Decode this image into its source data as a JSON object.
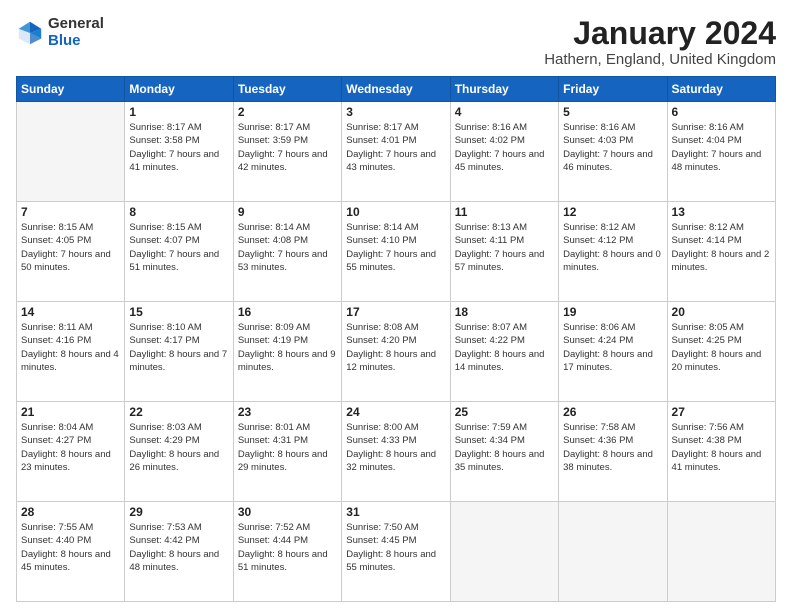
{
  "logo": {
    "general": "General",
    "blue": "Blue"
  },
  "header": {
    "month_title": "January 2024",
    "location": "Hathern, England, United Kingdom"
  },
  "days_of_week": [
    "Sunday",
    "Monday",
    "Tuesday",
    "Wednesday",
    "Thursday",
    "Friday",
    "Saturday"
  ],
  "weeks": [
    [
      {
        "day": "",
        "sunrise": "",
        "sunset": "",
        "daylight": ""
      },
      {
        "day": "1",
        "sunrise": "Sunrise: 8:17 AM",
        "sunset": "Sunset: 3:58 PM",
        "daylight": "Daylight: 7 hours and 41 minutes."
      },
      {
        "day": "2",
        "sunrise": "Sunrise: 8:17 AM",
        "sunset": "Sunset: 3:59 PM",
        "daylight": "Daylight: 7 hours and 42 minutes."
      },
      {
        "day": "3",
        "sunrise": "Sunrise: 8:17 AM",
        "sunset": "Sunset: 4:01 PM",
        "daylight": "Daylight: 7 hours and 43 minutes."
      },
      {
        "day": "4",
        "sunrise": "Sunrise: 8:16 AM",
        "sunset": "Sunset: 4:02 PM",
        "daylight": "Daylight: 7 hours and 45 minutes."
      },
      {
        "day": "5",
        "sunrise": "Sunrise: 8:16 AM",
        "sunset": "Sunset: 4:03 PM",
        "daylight": "Daylight: 7 hours and 46 minutes."
      },
      {
        "day": "6",
        "sunrise": "Sunrise: 8:16 AM",
        "sunset": "Sunset: 4:04 PM",
        "daylight": "Daylight: 7 hours and 48 minutes."
      }
    ],
    [
      {
        "day": "7",
        "sunrise": "Sunrise: 8:15 AM",
        "sunset": "Sunset: 4:05 PM",
        "daylight": "Daylight: 7 hours and 50 minutes."
      },
      {
        "day": "8",
        "sunrise": "Sunrise: 8:15 AM",
        "sunset": "Sunset: 4:07 PM",
        "daylight": "Daylight: 7 hours and 51 minutes."
      },
      {
        "day": "9",
        "sunrise": "Sunrise: 8:14 AM",
        "sunset": "Sunset: 4:08 PM",
        "daylight": "Daylight: 7 hours and 53 minutes."
      },
      {
        "day": "10",
        "sunrise": "Sunrise: 8:14 AM",
        "sunset": "Sunset: 4:10 PM",
        "daylight": "Daylight: 7 hours and 55 minutes."
      },
      {
        "day": "11",
        "sunrise": "Sunrise: 8:13 AM",
        "sunset": "Sunset: 4:11 PM",
        "daylight": "Daylight: 7 hours and 57 minutes."
      },
      {
        "day": "12",
        "sunrise": "Sunrise: 8:12 AM",
        "sunset": "Sunset: 4:12 PM",
        "daylight": "Daylight: 8 hours and 0 minutes."
      },
      {
        "day": "13",
        "sunrise": "Sunrise: 8:12 AM",
        "sunset": "Sunset: 4:14 PM",
        "daylight": "Daylight: 8 hours and 2 minutes."
      }
    ],
    [
      {
        "day": "14",
        "sunrise": "Sunrise: 8:11 AM",
        "sunset": "Sunset: 4:16 PM",
        "daylight": "Daylight: 8 hours and 4 minutes."
      },
      {
        "day": "15",
        "sunrise": "Sunrise: 8:10 AM",
        "sunset": "Sunset: 4:17 PM",
        "daylight": "Daylight: 8 hours and 7 minutes."
      },
      {
        "day": "16",
        "sunrise": "Sunrise: 8:09 AM",
        "sunset": "Sunset: 4:19 PM",
        "daylight": "Daylight: 8 hours and 9 minutes."
      },
      {
        "day": "17",
        "sunrise": "Sunrise: 8:08 AM",
        "sunset": "Sunset: 4:20 PM",
        "daylight": "Daylight: 8 hours and 12 minutes."
      },
      {
        "day": "18",
        "sunrise": "Sunrise: 8:07 AM",
        "sunset": "Sunset: 4:22 PM",
        "daylight": "Daylight: 8 hours and 14 minutes."
      },
      {
        "day": "19",
        "sunrise": "Sunrise: 8:06 AM",
        "sunset": "Sunset: 4:24 PM",
        "daylight": "Daylight: 8 hours and 17 minutes."
      },
      {
        "day": "20",
        "sunrise": "Sunrise: 8:05 AM",
        "sunset": "Sunset: 4:25 PM",
        "daylight": "Daylight: 8 hours and 20 minutes."
      }
    ],
    [
      {
        "day": "21",
        "sunrise": "Sunrise: 8:04 AM",
        "sunset": "Sunset: 4:27 PM",
        "daylight": "Daylight: 8 hours and 23 minutes."
      },
      {
        "day": "22",
        "sunrise": "Sunrise: 8:03 AM",
        "sunset": "Sunset: 4:29 PM",
        "daylight": "Daylight: 8 hours and 26 minutes."
      },
      {
        "day": "23",
        "sunrise": "Sunrise: 8:01 AM",
        "sunset": "Sunset: 4:31 PM",
        "daylight": "Daylight: 8 hours and 29 minutes."
      },
      {
        "day": "24",
        "sunrise": "Sunrise: 8:00 AM",
        "sunset": "Sunset: 4:33 PM",
        "daylight": "Daylight: 8 hours and 32 minutes."
      },
      {
        "day": "25",
        "sunrise": "Sunrise: 7:59 AM",
        "sunset": "Sunset: 4:34 PM",
        "daylight": "Daylight: 8 hours and 35 minutes."
      },
      {
        "day": "26",
        "sunrise": "Sunrise: 7:58 AM",
        "sunset": "Sunset: 4:36 PM",
        "daylight": "Daylight: 8 hours and 38 minutes."
      },
      {
        "day": "27",
        "sunrise": "Sunrise: 7:56 AM",
        "sunset": "Sunset: 4:38 PM",
        "daylight": "Daylight: 8 hours and 41 minutes."
      }
    ],
    [
      {
        "day": "28",
        "sunrise": "Sunrise: 7:55 AM",
        "sunset": "Sunset: 4:40 PM",
        "daylight": "Daylight: 8 hours and 45 minutes."
      },
      {
        "day": "29",
        "sunrise": "Sunrise: 7:53 AM",
        "sunset": "Sunset: 4:42 PM",
        "daylight": "Daylight: 8 hours and 48 minutes."
      },
      {
        "day": "30",
        "sunrise": "Sunrise: 7:52 AM",
        "sunset": "Sunset: 4:44 PM",
        "daylight": "Daylight: 8 hours and 51 minutes."
      },
      {
        "day": "31",
        "sunrise": "Sunrise: 7:50 AM",
        "sunset": "Sunset: 4:45 PM",
        "daylight": "Daylight: 8 hours and 55 minutes."
      },
      {
        "day": "",
        "sunrise": "",
        "sunset": "",
        "daylight": ""
      },
      {
        "day": "",
        "sunrise": "",
        "sunset": "",
        "daylight": ""
      },
      {
        "day": "",
        "sunrise": "",
        "sunset": "",
        "daylight": ""
      }
    ]
  ]
}
